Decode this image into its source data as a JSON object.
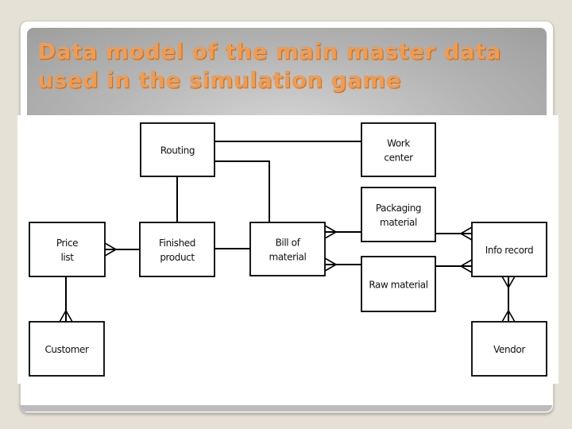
{
  "slide": {
    "title": "Data model of the main master data used in the simulation game"
  },
  "diagram": {
    "entities": {
      "routing": [
        "Routing"
      ],
      "work_center": [
        "Work",
        "center"
      ],
      "packaging_material": [
        "Packaging",
        "material"
      ],
      "raw_material": [
        "Raw material"
      ],
      "price_list": [
        "Price",
        "list"
      ],
      "finished_product": [
        "Finished",
        "product"
      ],
      "bill_of_material": [
        "Bill of",
        "material"
      ],
      "info_record": [
        "Info record"
      ],
      "customer": [
        "Customer"
      ],
      "vendor": [
        "Vendor"
      ]
    },
    "relationships": [
      {
        "from": "routing",
        "to": "work_center",
        "type": "one-to-one"
      },
      {
        "from": "routing",
        "to": "bill_of_material",
        "type": "one-to-one"
      },
      {
        "from": "routing",
        "to": "finished_product",
        "type": "one-to-one"
      },
      {
        "from": "finished_product",
        "to": "price_list",
        "type": "one-to-many"
      },
      {
        "from": "finished_product",
        "to": "bill_of_material",
        "type": "one-to-one"
      },
      {
        "from": "packaging_material",
        "to": "bill_of_material",
        "type": "one-to-many"
      },
      {
        "from": "raw_material",
        "to": "bill_of_material",
        "type": "one-to-many"
      },
      {
        "from": "packaging_material",
        "to": "info_record",
        "type": "one-to-many"
      },
      {
        "from": "raw_material",
        "to": "info_record",
        "type": "one-to-many"
      },
      {
        "from": "info_record",
        "to": "vendor",
        "type": "many-to-many"
      },
      {
        "from": "price_list",
        "to": "customer",
        "type": "one-to-many"
      }
    ],
    "colors": {
      "title": "#f59a4c",
      "header": "#b4b4b4",
      "stroke": "#000000"
    }
  }
}
